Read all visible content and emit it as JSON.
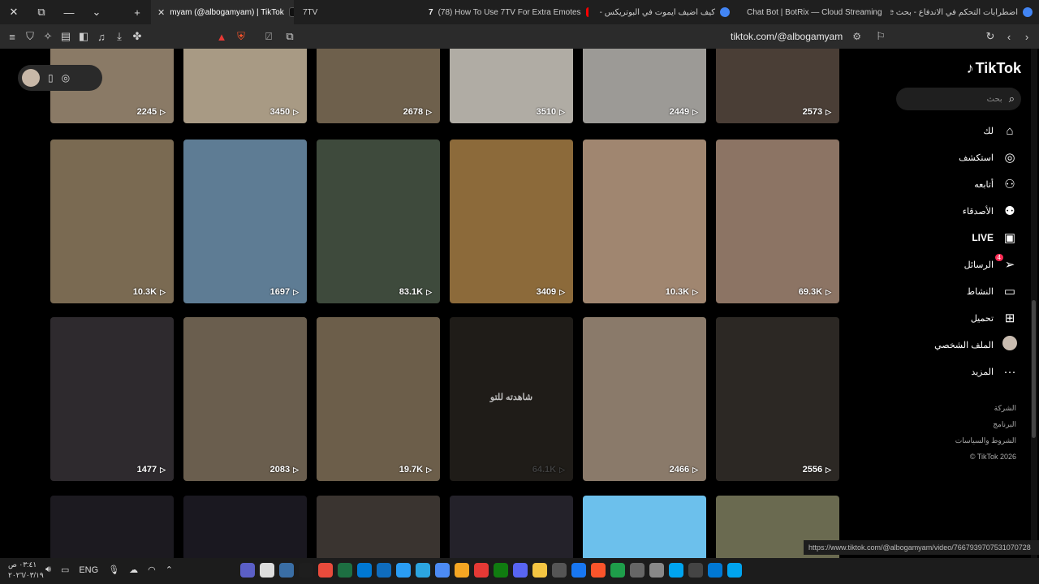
{
  "tabs": [
    {
      "title": "اضطرابات التحكم في الاندفاع - بحث Google",
      "color": "#4285f4"
    },
    {
      "title": "Chat Bot | BotRix — Cloud Streaming",
      "color": "#9b59ff"
    },
    {
      "title": "كيف اضيف ايموت في البوتريكس - بحث Google",
      "color": "#4285f4"
    },
    {
      "title": "(78) How To Use 7TV For Extra Emotes",
      "color": "#ff0000"
    },
    {
      "title": "7TV",
      "color": "#eeeeee"
    },
    {
      "title": "myam (@albogamyam) | TikTok",
      "color": "#111111",
      "active": true
    }
  ],
  "address_bar": {
    "url": "tiktok.com/@albogamyam"
  },
  "tiktok": {
    "logo_text": "TikTok",
    "search_placeholder": "بحث",
    "nav": [
      {
        "label": "لك",
        "icon": "home-icon",
        "glyph": "⌂"
      },
      {
        "label": "استكشف",
        "icon": "compass-icon",
        "glyph": "◎"
      },
      {
        "label": "أتابعه",
        "icon": "following-icon",
        "glyph": "⚇"
      },
      {
        "label": "الأصدقاء",
        "icon": "friends-icon",
        "glyph": "⚉"
      },
      {
        "label": "LIVE",
        "icon": "live-icon",
        "glyph": "▣"
      },
      {
        "label": "الرسائل",
        "icon": "messages-icon",
        "glyph": "➢",
        "badge": "4"
      },
      {
        "label": "النشاط",
        "icon": "activity-icon",
        "glyph": "▭"
      },
      {
        "label": "تحميل",
        "icon": "upload-icon",
        "glyph": "⊞"
      },
      {
        "label": "الملف الشخصي",
        "icon": "profile-avatar",
        "glyph": ""
      },
      {
        "label": "المزيد",
        "icon": "more-icon",
        "glyph": "···"
      }
    ],
    "footer": [
      "الشركة",
      "البرنامج",
      "الشروط والسياسات",
      "© TikTok 2026"
    ]
  },
  "videos": [
    {
      "views": "2245",
      "bg": "#8a7a66"
    },
    {
      "views": "3450",
      "bg": "#a89a84"
    },
    {
      "views": "2678",
      "bg": "#6e604c"
    },
    {
      "views": "3510",
      "bg": "#b0aca4"
    },
    {
      "views": "2449",
      "bg": "#9c9a96"
    },
    {
      "views": "2573",
      "bg": "#4a3e36"
    },
    {
      "views": "10.3K",
      "bg": "#7a6a52"
    },
    {
      "views": "1697",
      "bg": "#5e7c94"
    },
    {
      "views": "83.1K",
      "bg": "#3e4a3c"
    },
    {
      "views": "3409",
      "bg": "#8c6a3a"
    },
    {
      "views": "10.3K",
      "bg": "#a08670"
    },
    {
      "views": "69.3K",
      "bg": "#8c7464"
    },
    {
      "views": "1477",
      "bg": "#2e2a2e"
    },
    {
      "views": "2083",
      "bg": "#6a5e4e"
    },
    {
      "views": "19.7K",
      "bg": "#6c5e4a"
    },
    {
      "views": "64.1K",
      "bg": "#2a2620",
      "watched": "شاهدته للتو"
    },
    {
      "views": "2466",
      "bg": "#8a7a6a"
    },
    {
      "views": "2556",
      "bg": "#2c2824"
    },
    {
      "views": "",
      "bg": "#1c1a20"
    },
    {
      "views": "",
      "bg": "#1a1820"
    },
    {
      "views": "",
      "bg": "#3a3430"
    },
    {
      "views": "",
      "bg": "#24222a"
    },
    {
      "views": "",
      "bg": "#6cc0ec"
    },
    {
      "views": "",
      "bg": "#6a6a50"
    }
  ],
  "watched_label": "شاهدته للتو",
  "status_url": "https://www.tiktok.com/@albogamyam/video/7667939707531070728",
  "taskbar": {
    "lang": "ENG",
    "time": "٠٣:٤١ ص",
    "date": "٢٠٢٦/٠٣/١٩"
  }
}
